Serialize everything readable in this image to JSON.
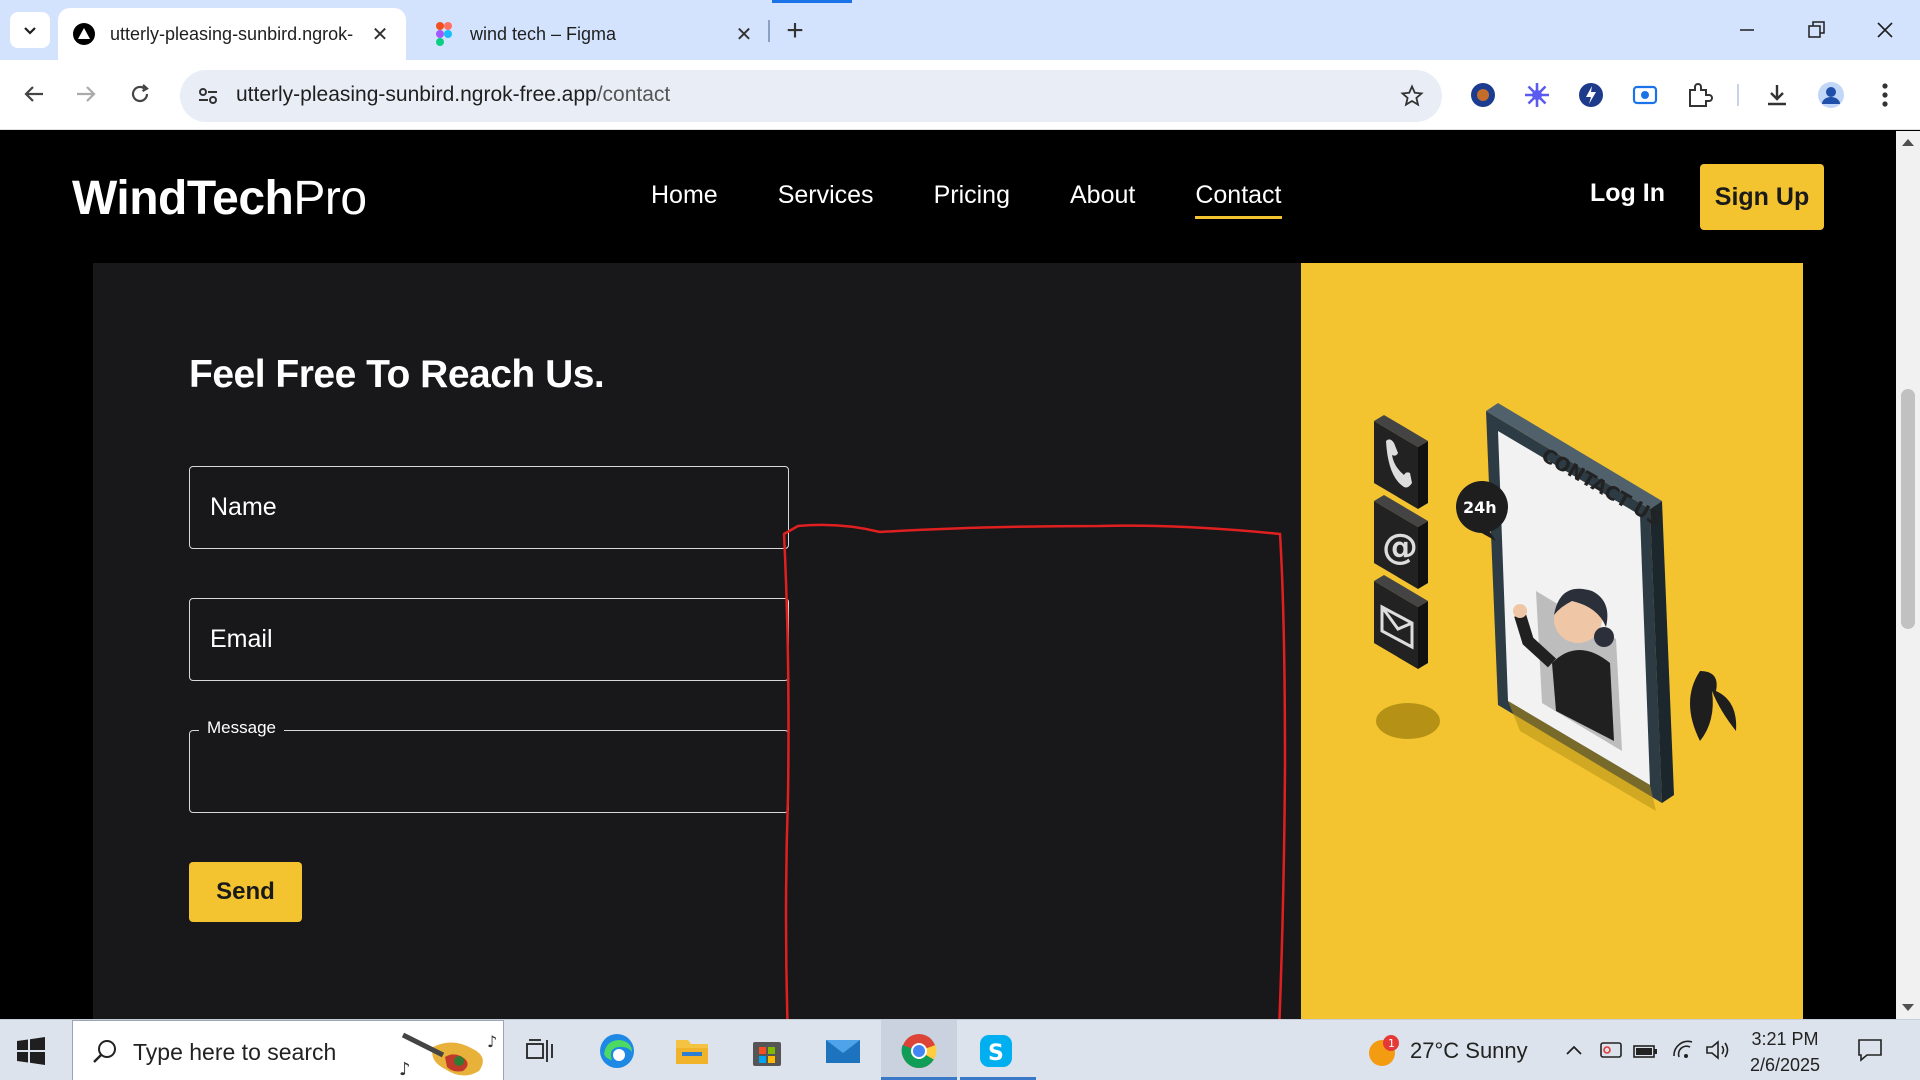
{
  "browser": {
    "tabs": [
      {
        "title": "utterly-pleasing-sunbird.ngrok-",
        "active": true
      },
      {
        "title": "wind tech – Figma",
        "active": false
      }
    ],
    "url_host": "utterly-pleasing-sunbird.ngrok-free.app",
    "url_path": "/contact"
  },
  "site": {
    "logo_bold": "WindTech",
    "logo_light": "Pro",
    "nav": [
      "Home",
      "Services",
      "Pricing",
      "About",
      "Contact"
    ],
    "active_nav": "Contact",
    "login": "Log In",
    "signup": "Sign Up"
  },
  "contact": {
    "heading": "Feel Free To Reach Us.",
    "name_placeholder": "Name",
    "email_placeholder": "Email",
    "message_label": "Message",
    "send_label": "Send"
  },
  "illustration": {
    "sign_text": "CONTACT US",
    "badge": "24h"
  },
  "taskbar": {
    "search_placeholder": "Type here to search",
    "weather": "27°C  Sunny",
    "weather_badge": "1",
    "time": "3:21 PM",
    "date": "2/6/2025"
  },
  "colors": {
    "accent_yellow": "#f4c430",
    "panel_dark": "#18171a",
    "annotation_red": "#e02020"
  }
}
